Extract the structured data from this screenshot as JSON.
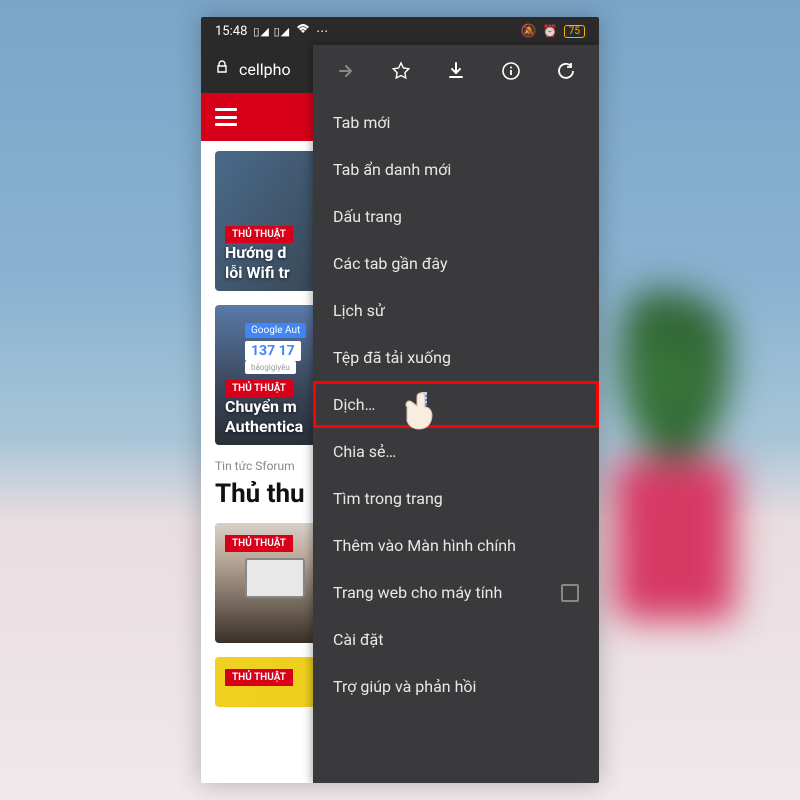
{
  "status": {
    "time": "15:48",
    "battery": "75"
  },
  "browser": {
    "url": "cellpho"
  },
  "site": {
    "articles": [
      {
        "tag": "THỦ THUẬT",
        "title": "Hướng d\nlỗi Wifi tr"
      },
      {
        "tag": "THỦ THUẬT",
        "title": "Chuyển m\nAuthentica",
        "code1": "Google Aut",
        "code2": "137 17",
        "code3": "bảogìgìyêu"
      },
      {
        "tag": "THỦ THUẬT",
        "title": "",
        "laptop": "MacBook Pro"
      },
      {
        "tag": "THỦ THUẬT",
        "title": ""
      }
    ],
    "breadcrumb": "Tin tức Sforum",
    "heading": "Thủ thu"
  },
  "menu": {
    "items": [
      "Tab mới",
      "Tab ẩn danh mới",
      "Dấu trang",
      "Các tab gần đây",
      "Lịch sử",
      "Tệp đã tải xuống",
      "Dịch…",
      "Chia sẻ…",
      "Tìm trong trang",
      "Thêm vào Màn hình chính",
      "Trang web cho máy tính",
      "Cài đặt",
      "Trợ giúp và phản hồi"
    ]
  }
}
